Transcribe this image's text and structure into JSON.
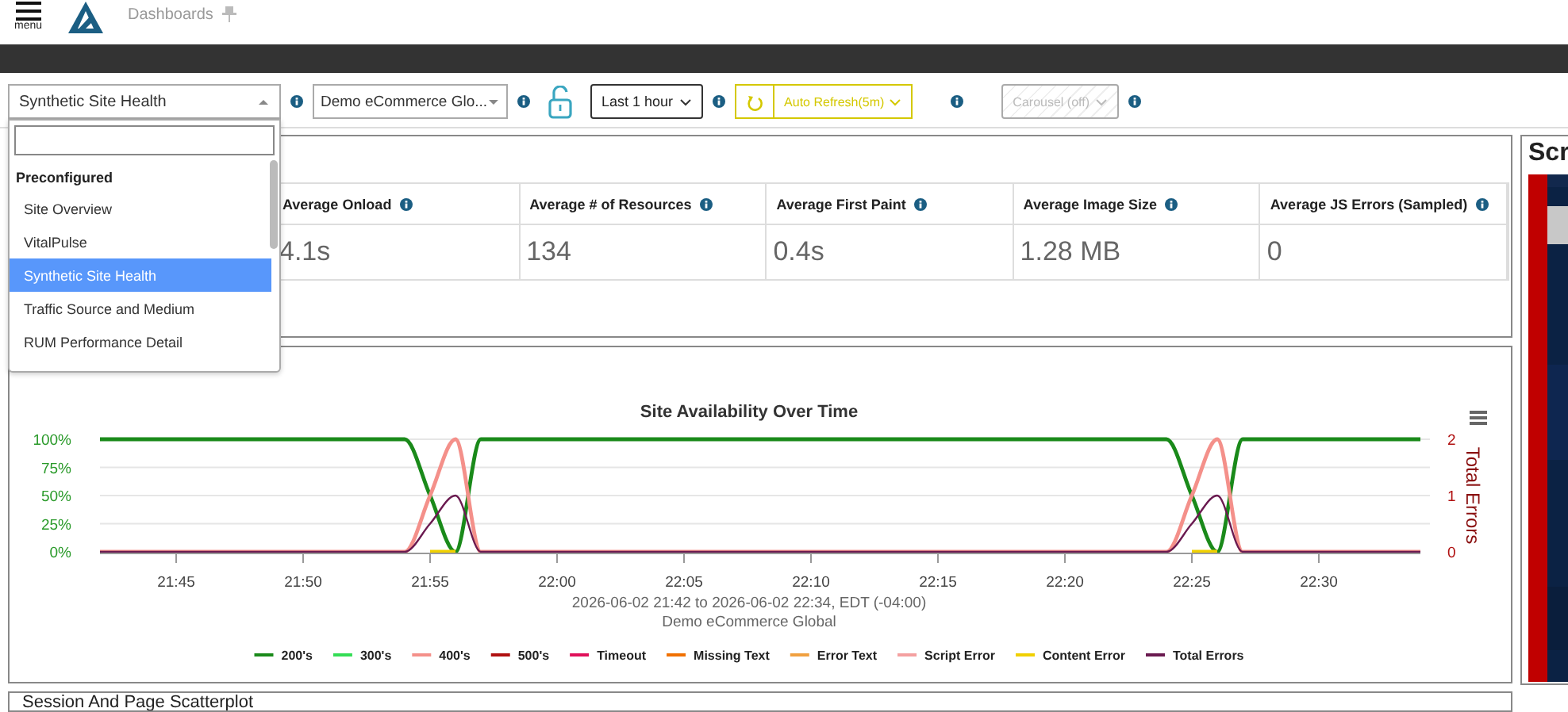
{
  "header": {
    "menu_label": "menu",
    "title": "Dashboards"
  },
  "toolbar": {
    "dashboard_select": {
      "value": "Synthetic Site Health",
      "expanded": true
    },
    "site_select": {
      "value": "Demo eCommerce Glo..."
    },
    "locked": false,
    "time_range": "Last 1 hour",
    "auto_refresh": "Auto Refresh(5m)",
    "carousel": {
      "label": "Carousel (off)",
      "disabled": true
    }
  },
  "dropdown": {
    "groups": [
      {
        "label": "Preconfigured",
        "items": [
          {
            "label": "Site Overview",
            "selected": false
          },
          {
            "label": "VitalPulse",
            "selected": false
          },
          {
            "label": "Synthetic Site Health",
            "selected": true
          },
          {
            "label": "Traffic Source and Medium",
            "selected": false
          },
          {
            "label": "RUM Performance Detail",
            "selected": false
          }
        ]
      }
    ]
  },
  "metrics": [
    {
      "label": "Average Onload",
      "value": "4.1s"
    },
    {
      "label": "Average # of Resources",
      "value": "134"
    },
    {
      "label": "Average First Paint",
      "value": "0.4s"
    },
    {
      "label": "Average Image Size",
      "value": "1.28 MB"
    },
    {
      "label": "Average JS Errors (Sampled)",
      "value": "0"
    }
  ],
  "availability_panel": {
    "chart_data": {
      "type": "line",
      "title": "Site Availability Over Time",
      "subtitle": [
        "2026-06-02 21:42 to 2026-06-02 22:34, EDT (-04:00)",
        "Demo eCommerce Global"
      ],
      "categories": [
        null,
        null,
        null,
        "21:45",
        null,
        null,
        null,
        null,
        "21:50",
        null,
        null,
        null,
        null,
        "21:55",
        null,
        null,
        null,
        null,
        "22:00",
        null,
        null,
        null,
        null,
        "22:05",
        null,
        null,
        null,
        null,
        "22:10",
        null,
        null,
        null,
        null,
        "22:15",
        null,
        null,
        null,
        null,
        "22:20",
        null,
        null,
        null,
        null,
        "22:25",
        null,
        null,
        null,
        null,
        "22:30",
        null,
        null,
        null,
        null
      ],
      "ylim": [
        0,
        100
      ],
      "yticks": [
        {
          "value": 0,
          "label": "0%"
        },
        {
          "value": 25,
          "label": "25%"
        },
        {
          "value": 50,
          "label": "50%"
        },
        {
          "value": 75,
          "label": "75%"
        },
        {
          "value": 100,
          "label": "100%"
        }
      ],
      "grid": true,
      "legend": true,
      "y2label": "Total Errors",
      "y2lim": [
        0,
        2
      ],
      "y2ticks": [
        {
          "value": 0,
          "label": "0"
        },
        {
          "value": 1,
          "label": "1"
        },
        {
          "value": 2,
          "label": "2"
        }
      ],
      "series": [
        {
          "name": "200's",
          "color": "#1a8a1a",
          "values": [
            100,
            100,
            100,
            100,
            100,
            100,
            100,
            100,
            100,
            100,
            100,
            100,
            100,
            50,
            0,
            100,
            100,
            100,
            100,
            100,
            100,
            100,
            100,
            100,
            100,
            100,
            100,
            100,
            100,
            100,
            100,
            100,
            100,
            100,
            100,
            100,
            100,
            100,
            100,
            100,
            100,
            100,
            100,
            50,
            0,
            100,
            100,
            100,
            100,
            100,
            100,
            100,
            100
          ]
        },
        {
          "name": "300's",
          "color": "#33dd55",
          "values": [
            null,
            null,
            null,
            null,
            null,
            null,
            null,
            null,
            null,
            null,
            null,
            null,
            null,
            null,
            null,
            null,
            null,
            null,
            null,
            null,
            null,
            null,
            null,
            null,
            null,
            null,
            null,
            null,
            null,
            null,
            null,
            null,
            null,
            null,
            null,
            null,
            null,
            null,
            null,
            null,
            null,
            null,
            null,
            null,
            null,
            null,
            null,
            null,
            null,
            null,
            null,
            null,
            null
          ]
        },
        {
          "name": "400's",
          "color": "#f4908a",
          "values": [
            0,
            0,
            0,
            0,
            0,
            0,
            0,
            0,
            0,
            0,
            0,
            0,
            0,
            50,
            100,
            0,
            0,
            0,
            0,
            0,
            0,
            0,
            0,
            0,
            0,
            0,
            0,
            0,
            0,
            0,
            0,
            0,
            0,
            0,
            0,
            0,
            0,
            0,
            0,
            0,
            0,
            0,
            0,
            50,
            100,
            0,
            0,
            0,
            0,
            0,
            0,
            0,
            0
          ]
        },
        {
          "name": "500's",
          "color": "#b01010",
          "values": [
            null,
            null,
            null,
            null,
            null,
            null,
            null,
            null,
            null,
            null,
            null,
            null,
            null,
            null,
            null,
            null,
            null,
            null,
            null,
            null,
            null,
            null,
            null,
            null,
            null,
            null,
            null,
            null,
            null,
            null,
            null,
            null,
            null,
            null,
            null,
            null,
            null,
            null,
            null,
            null,
            null,
            null,
            null,
            null,
            null,
            null,
            null,
            null,
            null,
            null,
            null,
            null,
            null
          ]
        },
        {
          "name": "Timeout",
          "color": "#e0105a",
          "values": [
            null,
            null,
            null,
            null,
            null,
            null,
            null,
            null,
            null,
            null,
            null,
            null,
            null,
            null,
            null,
            null,
            null,
            null,
            null,
            null,
            null,
            null,
            null,
            null,
            null,
            null,
            null,
            null,
            null,
            null,
            null,
            null,
            null,
            null,
            null,
            null,
            null,
            null,
            null,
            null,
            null,
            null,
            null,
            null,
            null,
            null,
            null,
            null,
            null,
            null,
            null,
            null,
            null
          ]
        },
        {
          "name": "Missing Text",
          "color": "#f07000",
          "values": [
            null,
            null,
            null,
            null,
            null,
            null,
            null,
            null,
            null,
            null,
            null,
            null,
            null,
            null,
            null,
            null,
            null,
            null,
            null,
            null,
            null,
            null,
            null,
            null,
            null,
            null,
            null,
            null,
            null,
            null,
            null,
            null,
            null,
            null,
            null,
            null,
            null,
            null,
            null,
            null,
            null,
            null,
            null,
            null,
            null,
            null,
            null,
            null,
            null,
            null,
            null,
            null,
            null
          ]
        },
        {
          "name": "Error Text",
          "color": "#f0a040",
          "values": [
            null,
            null,
            null,
            null,
            null,
            null,
            null,
            null,
            null,
            null,
            null,
            null,
            null,
            null,
            null,
            null,
            null,
            null,
            null,
            null,
            null,
            null,
            null,
            null,
            null,
            null,
            null,
            null,
            null,
            null,
            null,
            null,
            null,
            null,
            null,
            null,
            null,
            null,
            null,
            null,
            null,
            null,
            null,
            null,
            null,
            null,
            null,
            null,
            null,
            null,
            null,
            null,
            null
          ]
        },
        {
          "name": "Script Error",
          "color": "#f4a0a0",
          "values": [
            null,
            null,
            null,
            null,
            null,
            null,
            null,
            null,
            null,
            null,
            null,
            null,
            null,
            null,
            null,
            null,
            null,
            null,
            null,
            null,
            null,
            null,
            null,
            null,
            null,
            null,
            null,
            null,
            null,
            null,
            null,
            null,
            null,
            null,
            null,
            null,
            null,
            null,
            null,
            null,
            null,
            null,
            null,
            null,
            null,
            null,
            null,
            null,
            null,
            null,
            null,
            null,
            null
          ]
        },
        {
          "name": "Content Error",
          "color": "#f0d000",
          "values": [
            null,
            null,
            null,
            null,
            null,
            null,
            null,
            null,
            null,
            null,
            null,
            null,
            null,
            0,
            0,
            null,
            null,
            null,
            null,
            null,
            null,
            null,
            null,
            null,
            null,
            null,
            null,
            null,
            null,
            null,
            null,
            null,
            null,
            null,
            null,
            null,
            null,
            null,
            null,
            null,
            null,
            null,
            null,
            0,
            0,
            null,
            null,
            null,
            null,
            null,
            null,
            null,
            null
          ]
        },
        {
          "name": "Total Errors",
          "color": "#6a1a50",
          "axis": "y2",
          "values": [
            0,
            0,
            0,
            0,
            0,
            0,
            0,
            0,
            0,
            0,
            0,
            0,
            0,
            0.5,
            1,
            0,
            0,
            0,
            0,
            0,
            0,
            0,
            0,
            0,
            0,
            0,
            0,
            0,
            0,
            0,
            0,
            0,
            0,
            0,
            0,
            0,
            0,
            0,
            0,
            0,
            0,
            0,
            0,
            0.5,
            1,
            0,
            0,
            0,
            0,
            0,
            0,
            0,
            0
          ]
        }
      ]
    }
  },
  "side_panel": {
    "title": "Scr"
  },
  "scatter_panel": {
    "title": "Session And Page Scatterplot"
  }
}
